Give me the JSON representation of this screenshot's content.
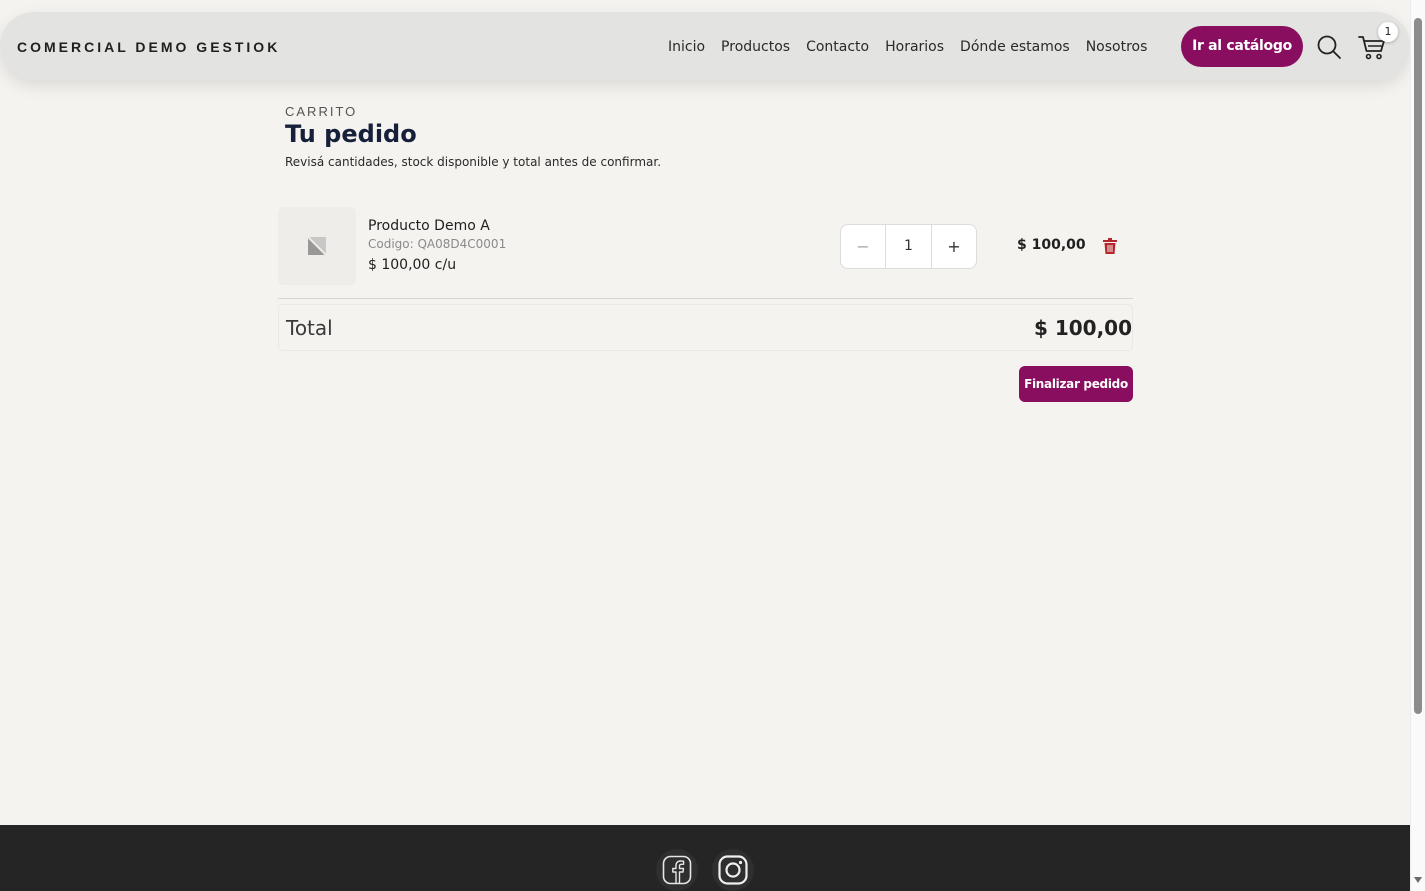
{
  "header": {
    "brand": "COMERCIAL DEMO GESTIOK",
    "nav": [
      {
        "label": "Inicio"
      },
      {
        "label": "Productos"
      },
      {
        "label": "Contacto"
      },
      {
        "label": "Horarios"
      },
      {
        "label": "Dónde estamos"
      },
      {
        "label": "Nosotros"
      }
    ],
    "catalog_button": "Ir al catálogo",
    "search_icon": "search-icon",
    "cart_icon": "cart-icon",
    "cart_count": "1"
  },
  "cart": {
    "eyebrow": "CARRITO",
    "title": "Tu pedido",
    "subtitle": "Revisá cantidades, stock disponible y total antes de confirmar.",
    "items": [
      {
        "name": "Producto Demo A",
        "code": "Codigo: QA08D4C0001",
        "unit_price": "$ 100,00 c/u",
        "quantity": "1",
        "line_total": "$ 100,00",
        "decrement": "−",
        "increment": "+"
      }
    ],
    "total_label": "Total",
    "total_value": "$ 100,00",
    "finish_button": "Finalizar pedido"
  },
  "footer": {
    "social": [
      {
        "icon": "facebook-icon"
      },
      {
        "icon": "instagram-icon"
      }
    ]
  },
  "colors": {
    "accent": "#8a0e5f",
    "background": "#f5f3ef",
    "footer": "#252525",
    "trash": "#b3262b"
  }
}
